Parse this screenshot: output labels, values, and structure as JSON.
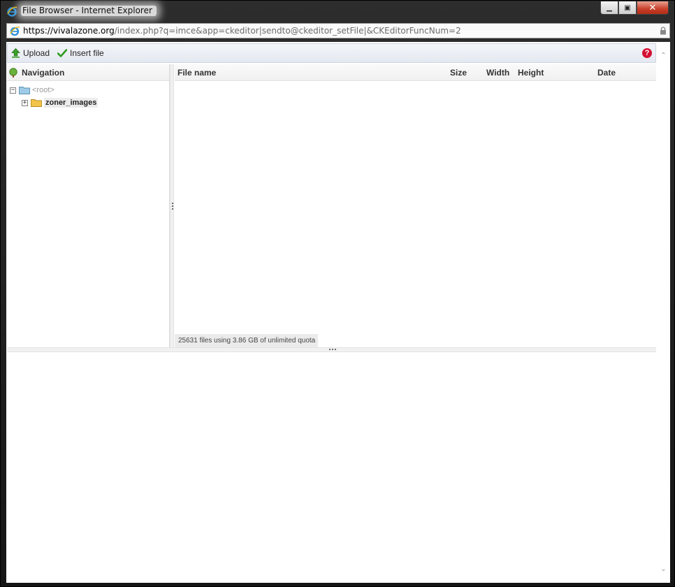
{
  "window": {
    "title": "File Browser - Internet Explorer",
    "minimize_glyph": "▁",
    "maximize_glyph": "▣",
    "close_glyph": "✕"
  },
  "addressbar": {
    "host": "https://vivalazone.org",
    "path": "/index.php?q=imce&app=ckeditor|sendto@ckeditor_setFile|&CKEditorFuncNum=2"
  },
  "toolbar": {
    "upload_label": "Upload",
    "insert_label": "Insert file",
    "help_glyph": "?"
  },
  "navigation": {
    "header": "Navigation",
    "root_label": "<root>",
    "root_expander": "−",
    "folders": [
      {
        "label": "zoner_images",
        "expander": "+"
      }
    ]
  },
  "file_list": {
    "columns": {
      "name": "File name",
      "size": "Size",
      "width": "Width",
      "height": "Height",
      "date": "Date"
    },
    "status": "25631 files using 3.86 GB of unlimited quota"
  },
  "scrollbar": {
    "up_glyph": "⌃",
    "down_glyph": "⌄"
  },
  "colors": {
    "help_accent": "#d41033",
    "upload_arrow": "#3aa02c",
    "insert_check": "#2e9b1f",
    "folder": "#f2c54a",
    "root_folder": "#9ecbe7"
  }
}
